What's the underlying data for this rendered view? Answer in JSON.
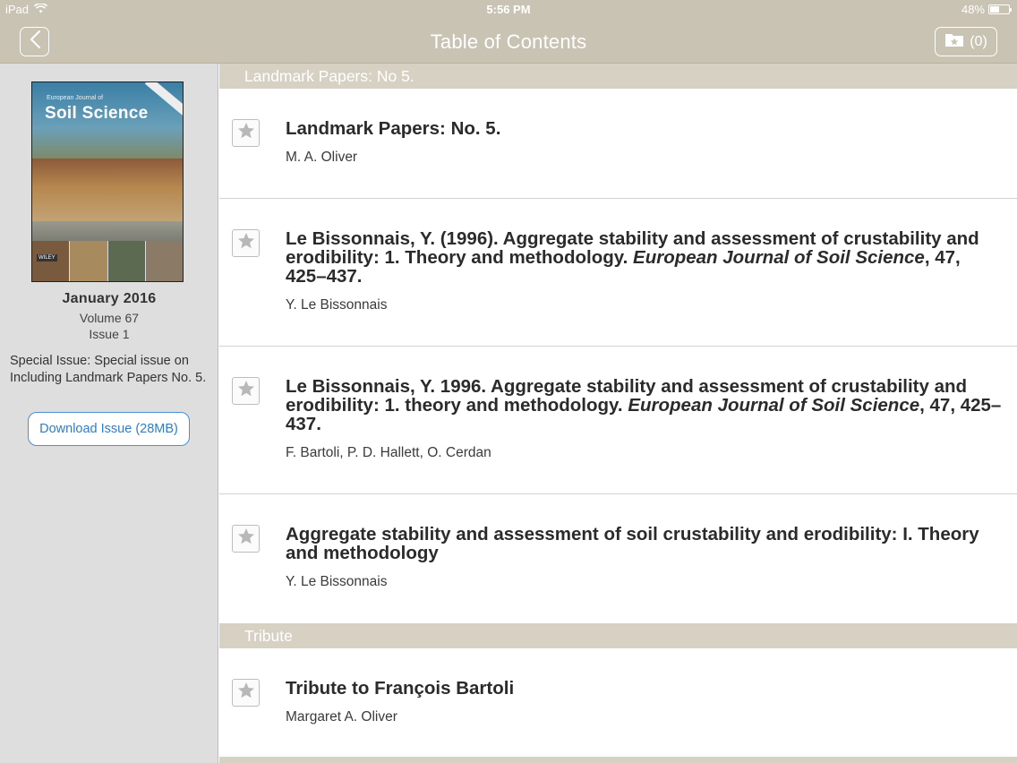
{
  "status_bar": {
    "device": "iPad",
    "time": "5:56 PM",
    "battery": "48%",
    "battery_level": 0.48
  },
  "nav": {
    "title": "Table of Contents",
    "favorites_count": "(0)",
    "back_icon": "chevron-left-icon",
    "favorites_icon": "folder-star-icon"
  },
  "issue": {
    "cover_title": "Soil Science",
    "cover_kicker": "European Journal of",
    "cover_publisher": "WILEY",
    "date": "January 2016",
    "volume": "Volume 67",
    "issue": "Issue 1",
    "special": "Special Issue: Special issue on Including Landmark Papers No. 5.",
    "download_label": "Download Issue (28MB)"
  },
  "sections": [
    {
      "header": "Landmark Papers: No 5.",
      "articles": [
        {
          "title": "Landmark Papers: No. 5.",
          "journal": "",
          "tail": "",
          "authors": "M. A. Oliver"
        },
        {
          "title": "Le Bissonnais, Y. (1996). Aggregate stability and assessment of crustability and erodibility: 1. Theory and methodology. ",
          "journal": "European Journal of Soil Science",
          "tail": ", 47, 425–437.",
          "authors": "Y. Le Bissonnais"
        },
        {
          "title": "Le Bissonnais, Y. 1996. Aggregate stability and assessment of crustability and erodibility: 1. theory and methodology. ",
          "journal": "European Journal of Soil Science",
          "tail": ", 47, 425–437.",
          "authors": "F. Bartoli, P. D. Hallett, O. Cerdan"
        },
        {
          "title": "Aggregate stability and assessment of soil crustability and erodibility: I. Theory and methodology",
          "journal": "",
          "tail": "",
          "authors": "Y. Le Bissonnais"
        }
      ]
    },
    {
      "header": "Tribute",
      "articles": [
        {
          "title": "Tribute to François Bartoli",
          "journal": "",
          "tail": "",
          "authors": "Margaret A. Oliver"
        }
      ]
    }
  ],
  "colors": {
    "bar": "#c9c3b3",
    "section_header": "#d6d1c3",
    "sidebar": "#dedede",
    "link": "#2f7cc9"
  }
}
